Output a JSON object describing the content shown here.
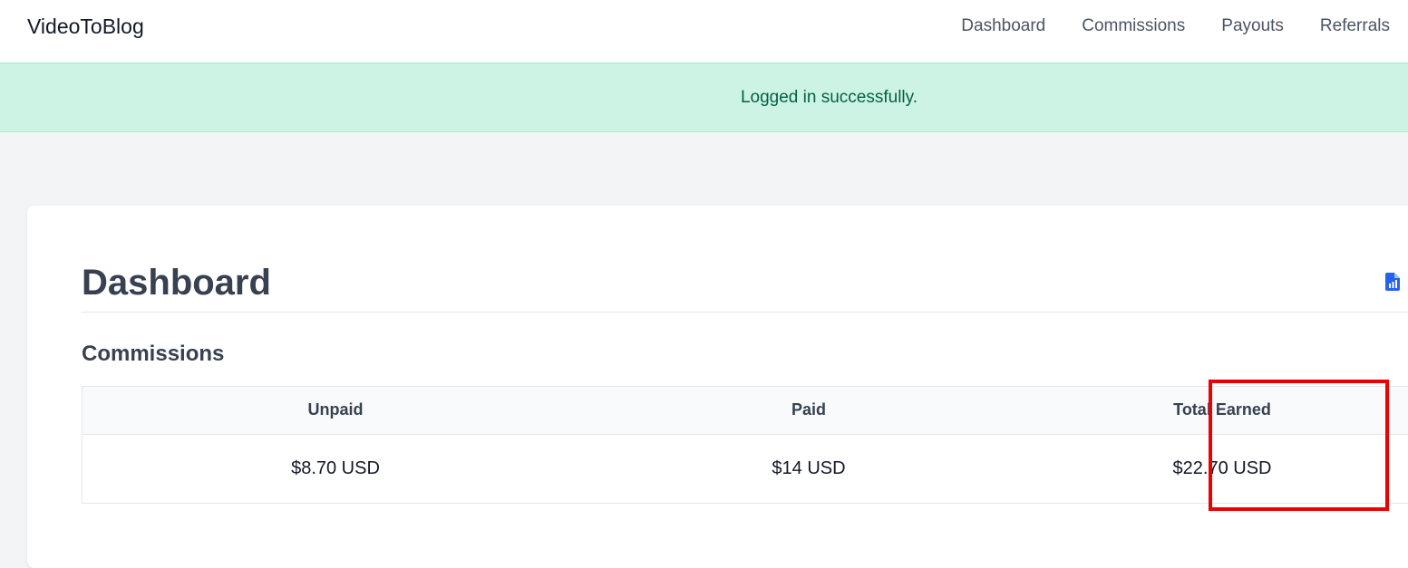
{
  "brand": "VideoToBlog",
  "nav": {
    "items": [
      {
        "label": "Dashboard"
      },
      {
        "label": "Commissions"
      },
      {
        "label": "Payouts"
      },
      {
        "label": "Referrals"
      }
    ]
  },
  "flash": {
    "message": "Logged in successfully.",
    "background": "#cdf3e5",
    "text_color": "#065f46"
  },
  "main": {
    "title": "Dashboard",
    "report_icon": "file-chart-icon",
    "accent": "#2563eb",
    "commissions": {
      "heading": "Commissions",
      "columns": [
        "Unpaid",
        "Paid",
        "Total Earned"
      ],
      "values": [
        "$8.70 USD",
        "$14 USD",
        "$22.70 USD"
      ]
    }
  },
  "annotation": {
    "highlight_color": "#ee0000",
    "highlighted_column": "Total Earned"
  }
}
